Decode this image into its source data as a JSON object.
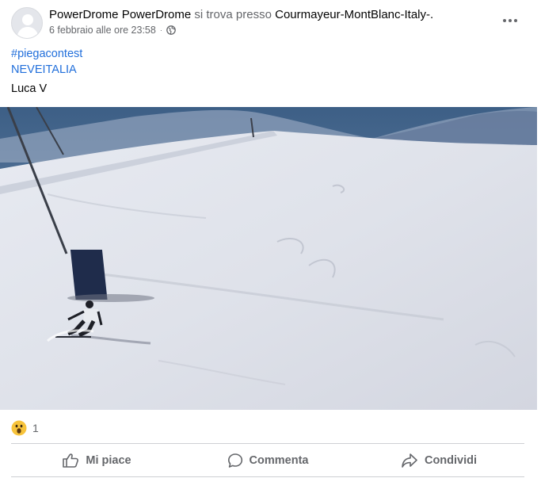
{
  "post": {
    "author": "PowerDrome PowerDrome",
    "at_text": "si trova presso",
    "place": "Courmayeur-MontBlanc-Italy-.",
    "timestamp": "6 febbraio alle ore 23:58",
    "privacy_icon": "globe-icon",
    "hashtags": [
      "#piegacontest",
      "NEVEITALIA"
    ],
    "caption": "Luca V"
  },
  "reactions": {
    "icon": "wow-emoji",
    "count": "1"
  },
  "actions": {
    "like": "Mi piace",
    "comment": "Commenta",
    "share": "Condividi"
  },
  "colors": {
    "hashtag": "#216fdb",
    "secondary_text": "#65676b",
    "divider": "#ced0d4"
  }
}
